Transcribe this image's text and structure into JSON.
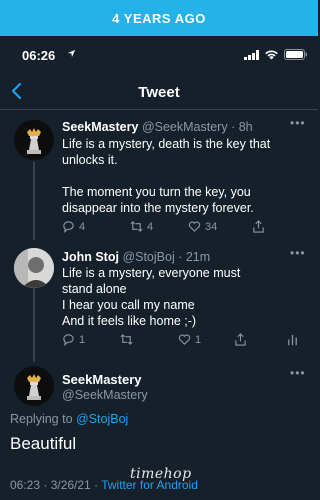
{
  "banner": {
    "text": "4 YEARS AGO",
    "color": "#25b2e8"
  },
  "status_bar": {
    "time": "06:26"
  },
  "nav": {
    "title": "Tweet"
  },
  "tweets": [
    {
      "name": "SeekMastery",
      "handle": "@SeekMastery",
      "time": "· 8h",
      "text": "Life is a mystery, death is the key that unlocks it.\n\nThe moment you turn the key, you disappear into the mystery forever.",
      "replies": "4",
      "retweets": "4",
      "likes": "34"
    },
    {
      "name": "John Stoj",
      "handle": "@StojBoj",
      "time": "· 21m",
      "text": "Life is a mystery, everyone must stand alone\nI hear you call my name\nAnd it feels like home ;-)",
      "replies": "1",
      "retweets": "",
      "likes": "1"
    }
  ],
  "main_tweet": {
    "name": "SeekMastery",
    "handle": "@SeekMastery",
    "replying_prefix": "Replying to",
    "replying_to": "@StojBoj",
    "text": "Beautiful",
    "timestamp": "06:23 · 3/26/21 · ",
    "client": "Twitter for Android"
  },
  "watermark": "timehop",
  "colors": {
    "background": "#15202b",
    "accent": "#1da1f2",
    "muted": "#8899a6"
  }
}
